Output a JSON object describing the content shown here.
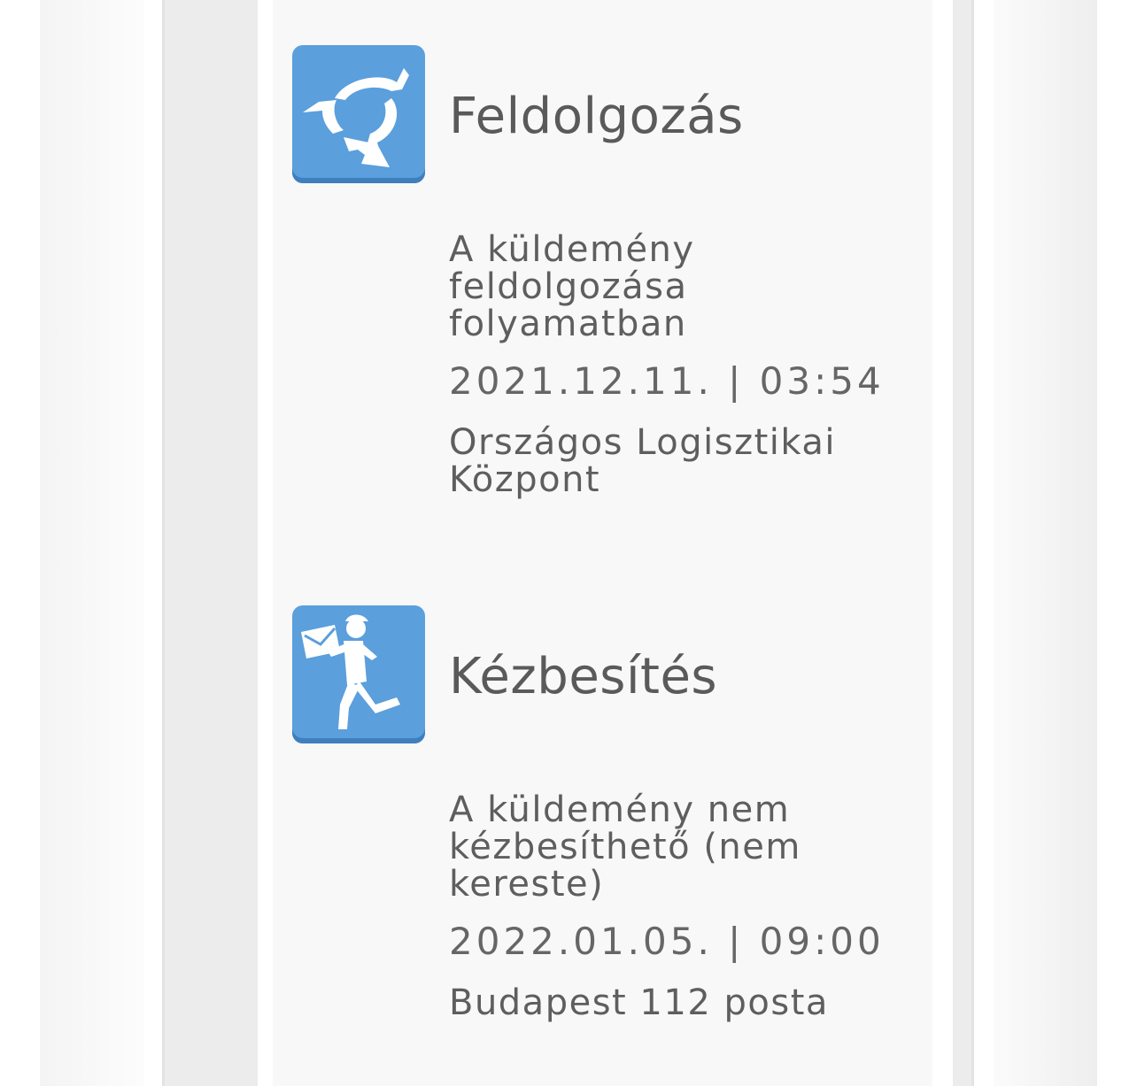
{
  "timeline": {
    "entries": [
      {
        "icon": "processing-arrows-icon",
        "title": "Feldolgozás",
        "description": "A küldemény feldolgozása folyamatban",
        "datetime": "2021.12.11. | 03:54",
        "location": "Országos Logisztikai Központ"
      },
      {
        "icon": "courier-delivery-icon",
        "title": "Kézbesítés",
        "description": "A küldemény nem kézbesíthető (nem kereste)",
        "datetime": "2022.01.05. | 09:00",
        "location": "Budapest 112 posta"
      }
    ]
  },
  "colors": {
    "icon_background": "#5b9fdc",
    "icon_shadow": "#3f7fbd",
    "text": "#5a5a5a",
    "card_background": "#f8f8f8"
  }
}
